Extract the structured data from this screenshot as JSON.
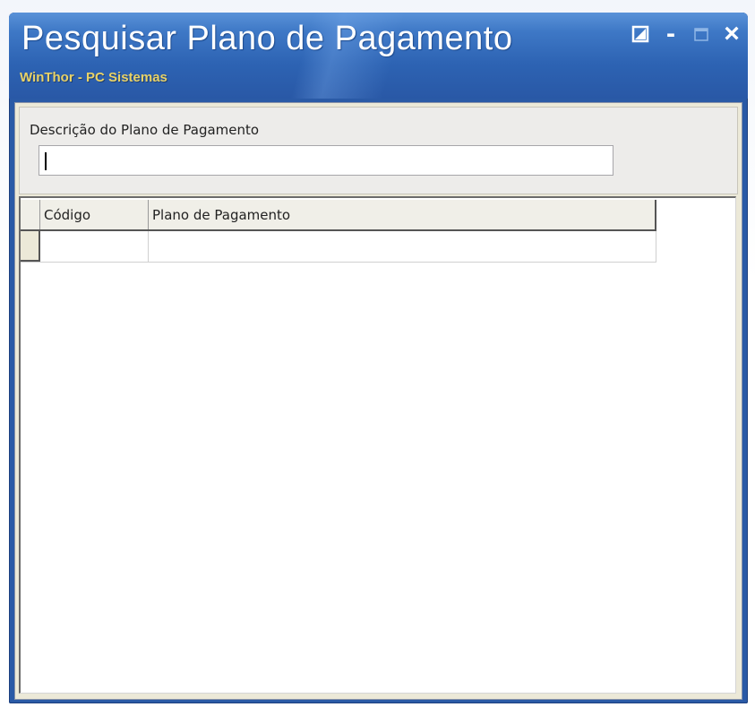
{
  "window": {
    "title": "Pesquisar Plano de Pagamento",
    "subtitle": "WinThor - PC Sistemas",
    "controls": {
      "restore_icon": "resize-icon",
      "minimize_label": "-",
      "maximize_icon": "maximize-icon",
      "close_label": "×"
    }
  },
  "filter": {
    "label": "Descrição do Plano de Pagamento",
    "value": "",
    "placeholder": ""
  },
  "grid": {
    "columns": [
      "Código",
      "Plano de Pagamento"
    ],
    "rows": [
      [
        "",
        ""
      ]
    ]
  },
  "colors": {
    "titlebar": "#2d63b3",
    "subtitle": "#e8d268",
    "client_bg": "#ece9d8"
  }
}
